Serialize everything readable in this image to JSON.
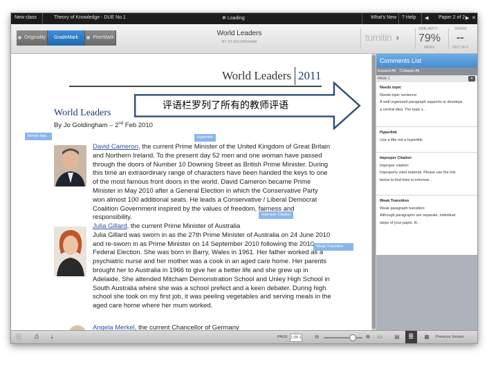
{
  "topbar": {
    "new_class": "New class",
    "breadcrumb": "Theory of Knowledge - DUE No.1",
    "loading": "Loading",
    "whats_new": "What's New",
    "help": "Help",
    "page_indicator": "Paper 2 of 2"
  },
  "modes": [
    {
      "label": "Originality",
      "active": false
    },
    {
      "label": "GradeMark",
      "active": true
    },
    {
      "label": "PeerMark",
      "active": false
    }
  ],
  "header": {
    "doc_title": "World Leaders",
    "doc_author": "BY JO GOLDINGHAM",
    "brand": "turnitin",
    "similarity_label": "SIMILARITY",
    "similarity_value": "79%",
    "similarity_sub": "INDEX",
    "grade_label": "GRADE",
    "grade_value": "--",
    "grade_sub": "OUT OF 0"
  },
  "document": {
    "header_title": "World Leaders",
    "header_year": "2011",
    "heading": "World Leaders",
    "byline_prefix": "By Jo Goldingham – 2",
    "byline_sup": "nd",
    "byline_suffix": " Feb 2010",
    "para1_link": "David Cameron",
    "para1_text": ", the current Prime Minister of the United Kingdom of Great Britain and Northern Ireland. To the present day 52 men and one woman have passed through the doors of Number 10 Downing Street as British Prime Minister. During this time an extraordinary range of characters have been handed the keys to one of the most famous front doors in the world. David Cameron became Prime Minister in May 2010 after a General Election in which the Conservative Party won almost 100 additional seats. He leads a Conservative / Liberal Democrat Coalition Government inspired by the values of freedom, fairness and responsibility.",
    "para2_link": "Julia Gillard",
    "para2_text": ", the current Prime Minister of Australia\nJulia Gillard was sworn in as the 27th Prime Minister of Australia on 24 June 2010 and re-sworn in as Prime Minister on 14 September 2010 following the 2010 Federal Election. She was born in Barry, Wales in 1961.  Her father worked as a psychiatric nurse and her mother was a cook in an aged care home.  Her parents brought her to Australia in 1966 to give her a better life and she grew up in Adelaide.  She attended Mitcham Demonstration School and Unley High School in South Australia where she was a school prefect and a keen debater.  During high school she took on my first job, it was peeling vegetables and serving meals in the aged care home where her mum worked.",
    "para3_link": "Angela Merkel",
    "para3_text": ", the current Chancellor of Germany"
  },
  "tags": {
    "needs_topic": "Needs topi...",
    "hyperlink": "Hyperlink",
    "improper_citation": "Improper Citation",
    "weak_transition": "Weak Transition"
  },
  "callout": {
    "text": "评语栏罗列了所有的教师评语"
  },
  "comments_panel": {
    "title": "Comments List",
    "expand_all": "Expand All",
    "collapse_all": "Collapse All",
    "page": "PAGE 1",
    "count": "4",
    "items": [
      {
        "title": "Needs topic",
        "lines": [
          "Needs topic sentence:",
          "A well-organized paragraph supports or develops",
          "a central idea. The topic s"
        ],
        "more": "..."
      },
      {
        "title": "Hyperlink",
        "lines": [
          "Use a title not a hyperlink"
        ],
        "more": ""
      },
      {
        "title": "Improper Citation",
        "lines": [
          "Improper citation:",
          "Improperly cited material. Please use the link",
          "below to find links to informat"
        ],
        "more": "..."
      },
      {
        "title": "Weak Transition",
        "lines": [
          "Weak paragraph transition:",
          "Although paragraphs are separate, individual",
          "steps of your paper, iti"
        ],
        "more": "..."
      }
    ]
  },
  "bottombar": {
    "page_label": "PAGE",
    "page_value": "1 OF 1",
    "previous_version": "Previous Version"
  }
}
